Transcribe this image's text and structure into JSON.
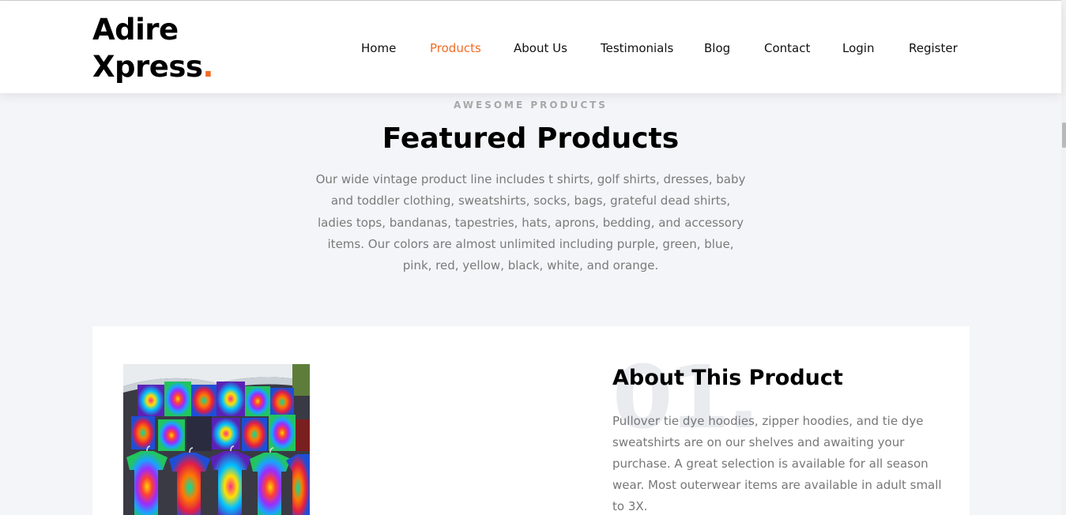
{
  "brand": {
    "line1": "Adire",
    "line2": "Xpress",
    "dot": "."
  },
  "nav": {
    "items": [
      {
        "label": "Home",
        "active": false
      },
      {
        "label": "Products",
        "active": true
      },
      {
        "label": "About Us",
        "active": false
      },
      {
        "label": "Testimonials",
        "active": false
      },
      {
        "label": "Blog",
        "active": false
      },
      {
        "label": "Contact",
        "active": false
      },
      {
        "label": "Login",
        "active": false
      },
      {
        "label": "Register",
        "active": false
      }
    ]
  },
  "section": {
    "eyebrow": "AWESOME PRODUCTS",
    "title": "Featured Products",
    "intro": "Our wide vintage product line includes t shirts, golf shirts, dresses, baby and toddler clothing, sweatshirts, socks, bags, grateful dead shirts, ladies tops, bandanas, tapestries, hats, aprons, bedding, and accessory items. Our colors are almost unlimited including purple, green, blue, pink, red, yellow, black, white, and orange."
  },
  "product": {
    "number": "01.",
    "title": "About This Product",
    "description": "Pullover tie dye hoodies, zipper hoodies, and tie dye sweatshirts are on our shelves and awaiting your purchase. A great selection is available for all season wear. Most outerwear items are available in adult small to 3X.",
    "image_icon": "tie-dye-shirts-photo"
  },
  "colors": {
    "accent": "#f26b24",
    "background": "#f4f5f8",
    "text_muted": "#777777",
    "heading": "#000000"
  }
}
